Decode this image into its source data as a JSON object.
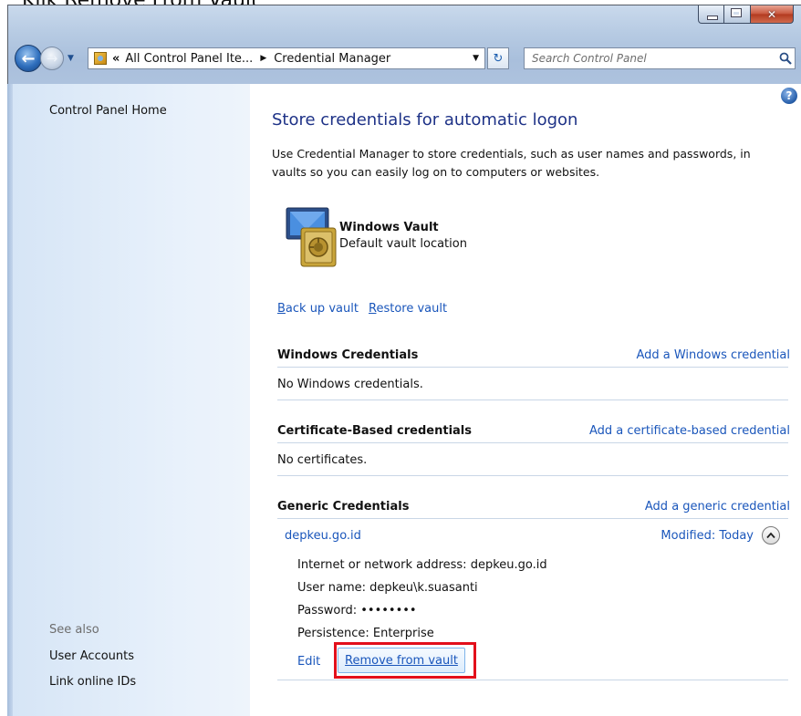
{
  "caption": "Klik Remove From Vault",
  "nav": {
    "address": {
      "chevron": "«",
      "crumb1": "All Control Panel Ite...",
      "crumb2": "Credential Manager"
    },
    "search_placeholder": "Search Control Panel"
  },
  "sidebar": {
    "home": "Control Panel Home",
    "see_also": "See also",
    "user_accounts": "User Accounts",
    "link_online_ids": "Link online IDs"
  },
  "main": {
    "title": "Store credentials for automatic logon",
    "description": "Use Credential Manager to store credentials, such as user names and passwords, in vaults so you can easily log on to computers or websites.",
    "vault": {
      "name": "Windows Vault",
      "desc": "Default vault location"
    },
    "backup_first": "B",
    "backup_rest": "ack up vault",
    "restore_first": "R",
    "restore_rest": "estore vault",
    "sections": {
      "windows": {
        "title": "Windows Credentials",
        "add": "Add a Windows credential",
        "empty": "No Windows credentials."
      },
      "certificate": {
        "title": "Certificate-Based credentials",
        "add": "Add a certificate-based credential",
        "empty": "No certificates."
      },
      "generic": {
        "title": "Generic Credentials",
        "add": "Add a generic credential"
      }
    },
    "credential": {
      "name": "depkeu.go.id",
      "modified": "Modified:  Today",
      "address": "Internet or network address:  depkeu.go.id",
      "user": "User name:  depkeu\\k.suasanti",
      "password": "Password:  ••••••••",
      "persistence": "Persistence:  Enterprise",
      "edit": "Edit",
      "remove": "Remove from vault"
    }
  },
  "colors": {
    "link": "#1a56bb",
    "title": "#1e3287",
    "highlight": "#e3101b"
  }
}
